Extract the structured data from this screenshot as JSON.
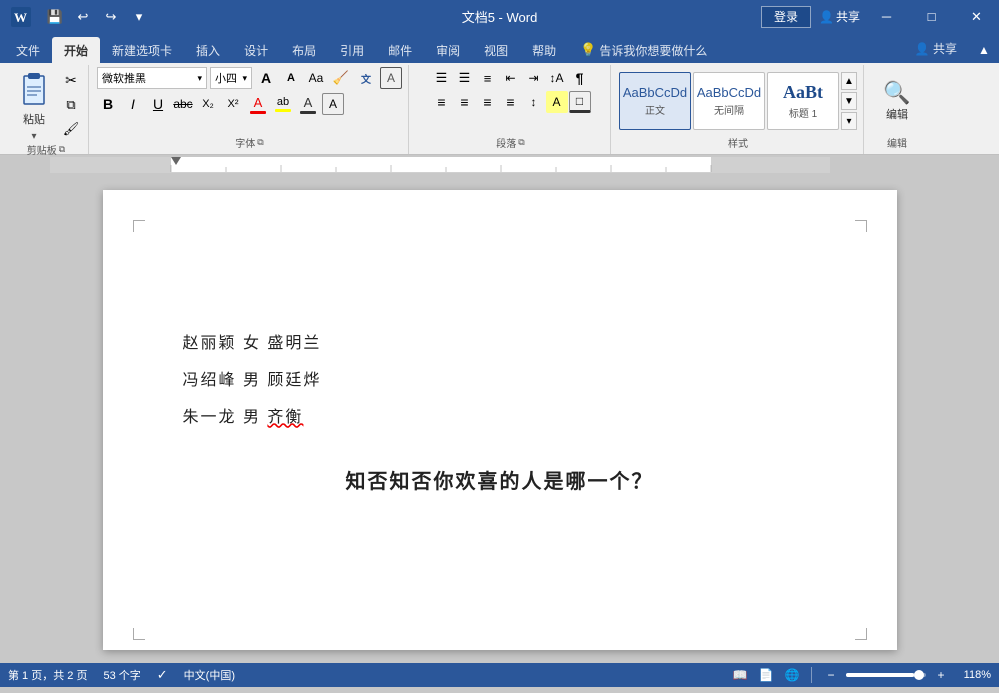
{
  "titlebar": {
    "title": "文档5 - Word",
    "quick_access": [
      "save",
      "undo",
      "redo",
      "customize"
    ],
    "login_label": "登录",
    "share_label": "共享",
    "min_label": "─",
    "max_label": "□",
    "close_label": "✕"
  },
  "ribbon": {
    "tabs": [
      "文件",
      "开始",
      "新建选项卡",
      "插入",
      "设计",
      "布局",
      "引用",
      "邮件",
      "审阅",
      "视图",
      "帮助",
      "告诉我你想要做什么"
    ],
    "active_tab": "开始",
    "groups": {
      "clipboard": {
        "label": "剪贴板",
        "paste_label": "粘贴"
      },
      "font": {
        "label": "字体",
        "font_name": "微软推黑",
        "font_size": "小四"
      },
      "paragraph": {
        "label": "段落"
      },
      "styles": {
        "label": "样式",
        "items": [
          "正文",
          "无间隔",
          "标题 1"
        ]
      },
      "editing": {
        "label": "编辑"
      }
    }
  },
  "document": {
    "lines": [
      {
        "text": "赵丽颖  女  盛明兰",
        "bold": false
      },
      {
        "text": "冯绍峰  男  顾廷烨",
        "bold": false
      },
      {
        "text": "朱一龙  男  齐衡",
        "bold": false,
        "squiggly": true
      }
    ],
    "bold_line": "知否知否你欢喜的人是哪一个？"
  },
  "statusbar": {
    "page_info": "第 1 页，共 2 页",
    "word_count": "53 个字",
    "language": "中文(中国)",
    "zoom": "118%"
  },
  "styles_panel": {
    "style1_text": "AaBbCcDd",
    "style1_label": "正文",
    "style2_text": "AaBbCcDd",
    "style2_label": "无间隔",
    "style3_text": "AaBt",
    "style3_label": "标题 1"
  }
}
